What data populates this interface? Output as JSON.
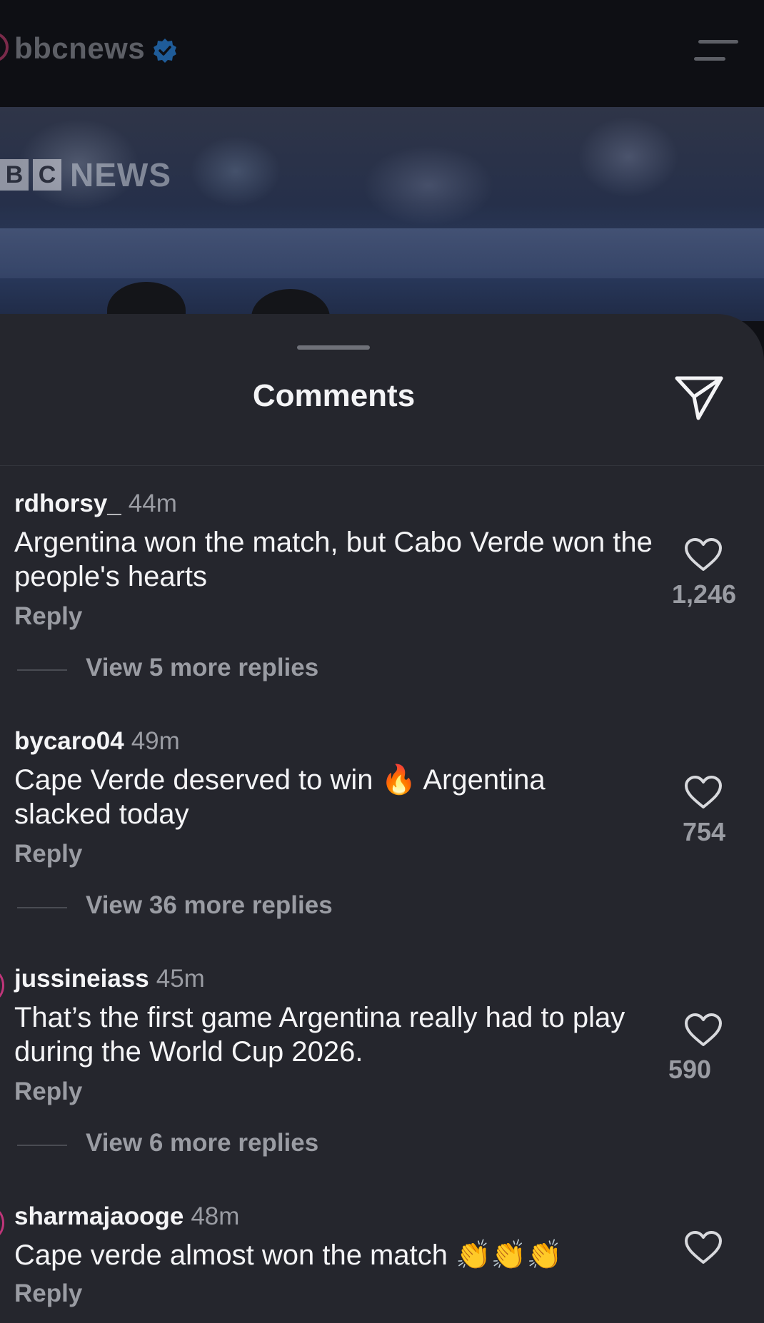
{
  "header": {
    "account_name": "bbcnews"
  },
  "photo": {
    "logo_b1": "B",
    "logo_b2": "C",
    "logo_news": "NEWS"
  },
  "sheet": {
    "title": "Comments"
  },
  "comments": [
    {
      "username": "rdhorsy_",
      "time": "44m",
      "text": "Argentina won the match, but Cabo Verde won the people's hearts",
      "reply_label": "Reply",
      "view_replies": "View 5 more replies",
      "likes": "1,246"
    },
    {
      "username": "bycaro04",
      "time": "49m",
      "text": "Cape Verde deserved to win 🔥 Argentina slacked today",
      "reply_label": "Reply",
      "view_replies": "View 36 more replies",
      "likes": "754"
    },
    {
      "username": "jussineiass",
      "time": "45m",
      "text": "That’s the first game Argentina really had to play during the World Cup 2026.",
      "reply_label": "Reply",
      "view_replies": "View 6 more replies",
      "likes": "590"
    },
    {
      "username": "sharmajaooge",
      "time": "48m",
      "text": "Cape verde almost won the match 👏👏👏",
      "reply_label": "Reply",
      "view_replies": "",
      "likes": ""
    }
  ],
  "colors": {
    "sheet_bg": "#25262d",
    "text_primary": "#f4f4f6",
    "text_secondary": "#9a9ca3",
    "verified_blue": "#3a8fd9"
  },
  "icons": {
    "verified": "verified-badge-icon",
    "menu": "hamburger-menu-icon",
    "share": "paper-plane-icon",
    "like": "heart-outline-icon"
  }
}
